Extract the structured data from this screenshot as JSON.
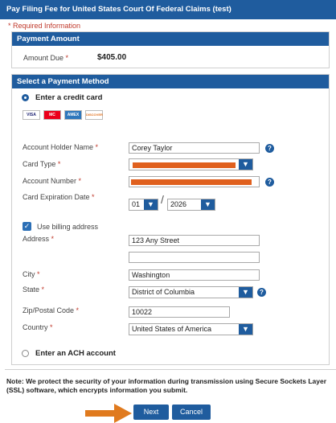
{
  "title": "Pay Filing Fee for United States Court Of Federal Claims (test)",
  "required_info": "* Required Information",
  "payment_amount": {
    "header": "Payment Amount",
    "label": "Amount Due",
    "value": "$405.00"
  },
  "payment_method": {
    "header": "Select a Payment Method",
    "credit_option": "Enter a credit card",
    "ach_option": "Enter an ACH account",
    "cards": [
      "VISA",
      "MC",
      "AMEX",
      "DISCOVER"
    ]
  },
  "form": {
    "holder_label": "Account Holder Name",
    "holder_value": "Corey Taylor",
    "card_type_label": "Card Type",
    "account_number_label": "Account Number",
    "expiration_label": "Card Expiration Date",
    "exp_month": "01",
    "exp_separator": "/",
    "exp_year": "2026",
    "billing_label": "Use billing address",
    "address_label": "Address",
    "address1": "123 Any Street",
    "address2": "",
    "city_label": "City",
    "city_value": "Washington",
    "state_label": "State",
    "state_value": "District of Columbia",
    "zip_label": "Zip/Postal Code",
    "zip_value": "10022",
    "country_label": "Country",
    "country_value": "United States of America"
  },
  "note": "Note: We protect the security of your information during transmission using Secure Sockets Layer (SSL) software, which encrypts information you submit.",
  "buttons": {
    "next": "Next",
    "cancel": "Cancel"
  },
  "colors": {
    "brand_blue": "#1f5c9e",
    "arrow_orange": "#e07a1e",
    "redaction": "#e0601e"
  }
}
